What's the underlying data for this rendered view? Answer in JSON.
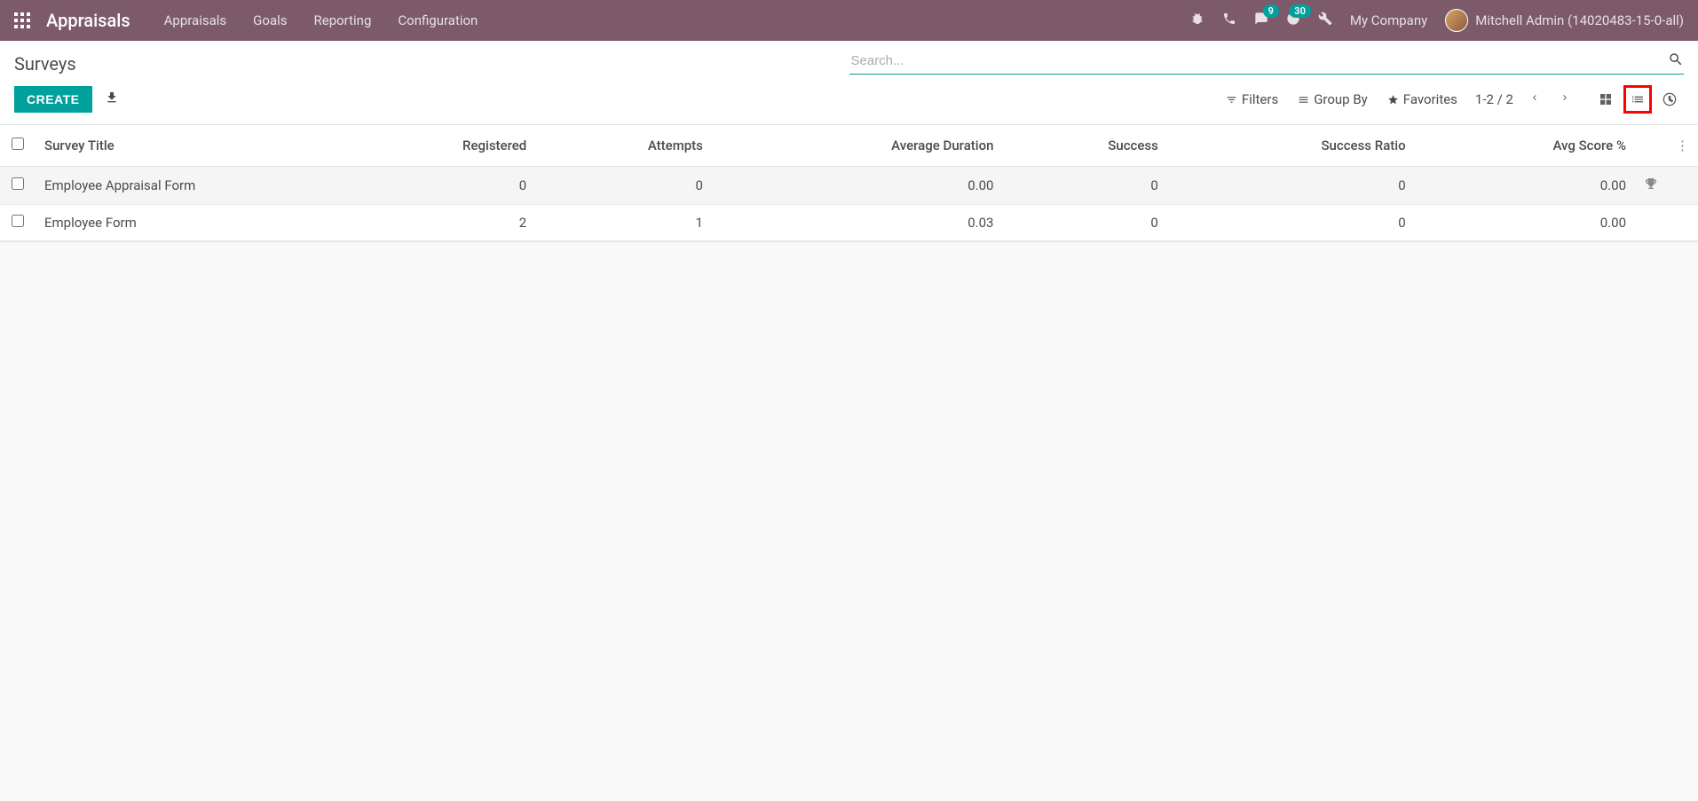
{
  "navbar": {
    "app_title": "Appraisals",
    "menu": [
      "Appraisals",
      "Goals",
      "Reporting",
      "Configuration"
    ],
    "messages_badge": "9",
    "activities_badge": "30",
    "company": "My Company",
    "user": "Mitchell Admin (14020483-15-0-all)"
  },
  "control": {
    "page_title": "Surveys",
    "search_placeholder": "Search...",
    "create_label": "CREATE",
    "filters_label": "Filters",
    "groupby_label": "Group By",
    "favorites_label": "Favorites",
    "pager_value": "1-2 / 2"
  },
  "table": {
    "headers": {
      "title": "Survey Title",
      "registered": "Registered",
      "attempts": "Attempts",
      "avg_duration": "Average Duration",
      "success": "Success",
      "success_ratio": "Success Ratio",
      "avg_score": "Avg Score %"
    },
    "rows": [
      {
        "title": "Employee Appraisal Form",
        "registered": "0",
        "attempts": "0",
        "avg_duration": "0.00",
        "success": "0",
        "success_ratio": "0",
        "avg_score": "0.00",
        "trophy": true
      },
      {
        "title": "Employee Form",
        "registered": "2",
        "attempts": "1",
        "avg_duration": "0.03",
        "success": "0",
        "success_ratio": "0",
        "avg_score": "0.00",
        "trophy": false
      }
    ]
  }
}
